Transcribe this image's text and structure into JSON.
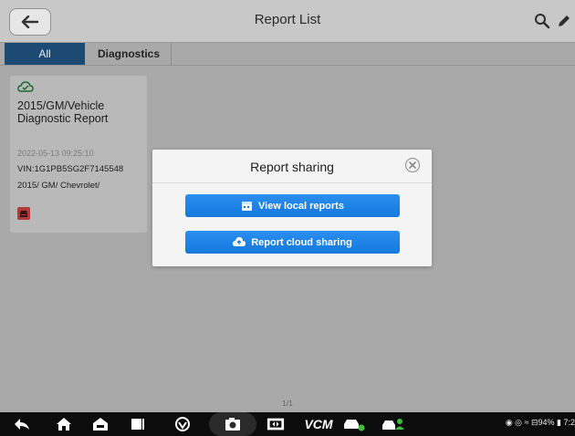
{
  "header": {
    "title": "Report List"
  },
  "tabs": [
    {
      "label": "All",
      "active": true
    },
    {
      "label": "Diagnostics",
      "active": false
    }
  ],
  "report": {
    "title": "2015/GM/Vehicle Diagnostic Report",
    "datetime": "2022-05-13 09:25:10",
    "vin": "VIN:1G1PB5SG2F7145548",
    "make": "2015/ GM/ Chevrolet/"
  },
  "dialog": {
    "title": "Report sharing",
    "view_local_label": "View local reports",
    "cloud_sharing_label": "Report cloud sharing"
  },
  "pagination": "1/1",
  "navbar": {
    "vcm_label": "VCM",
    "status_text": " ◉ ◎ ≈ ⊟94% ▮ 7:2"
  },
  "colors": {
    "accent": "#1c7fe6",
    "tab_active_bg": "#1c4a73",
    "overlay_bg": "#a9a9a9",
    "delete_icon_red": "#b33a3a"
  },
  "icons": [
    "back-arrow-icon",
    "search-icon",
    "edit-icon",
    "cloud-check-icon",
    "car-icon",
    "close-icon",
    "calendar-icon",
    "cloud-upload-icon"
  ]
}
